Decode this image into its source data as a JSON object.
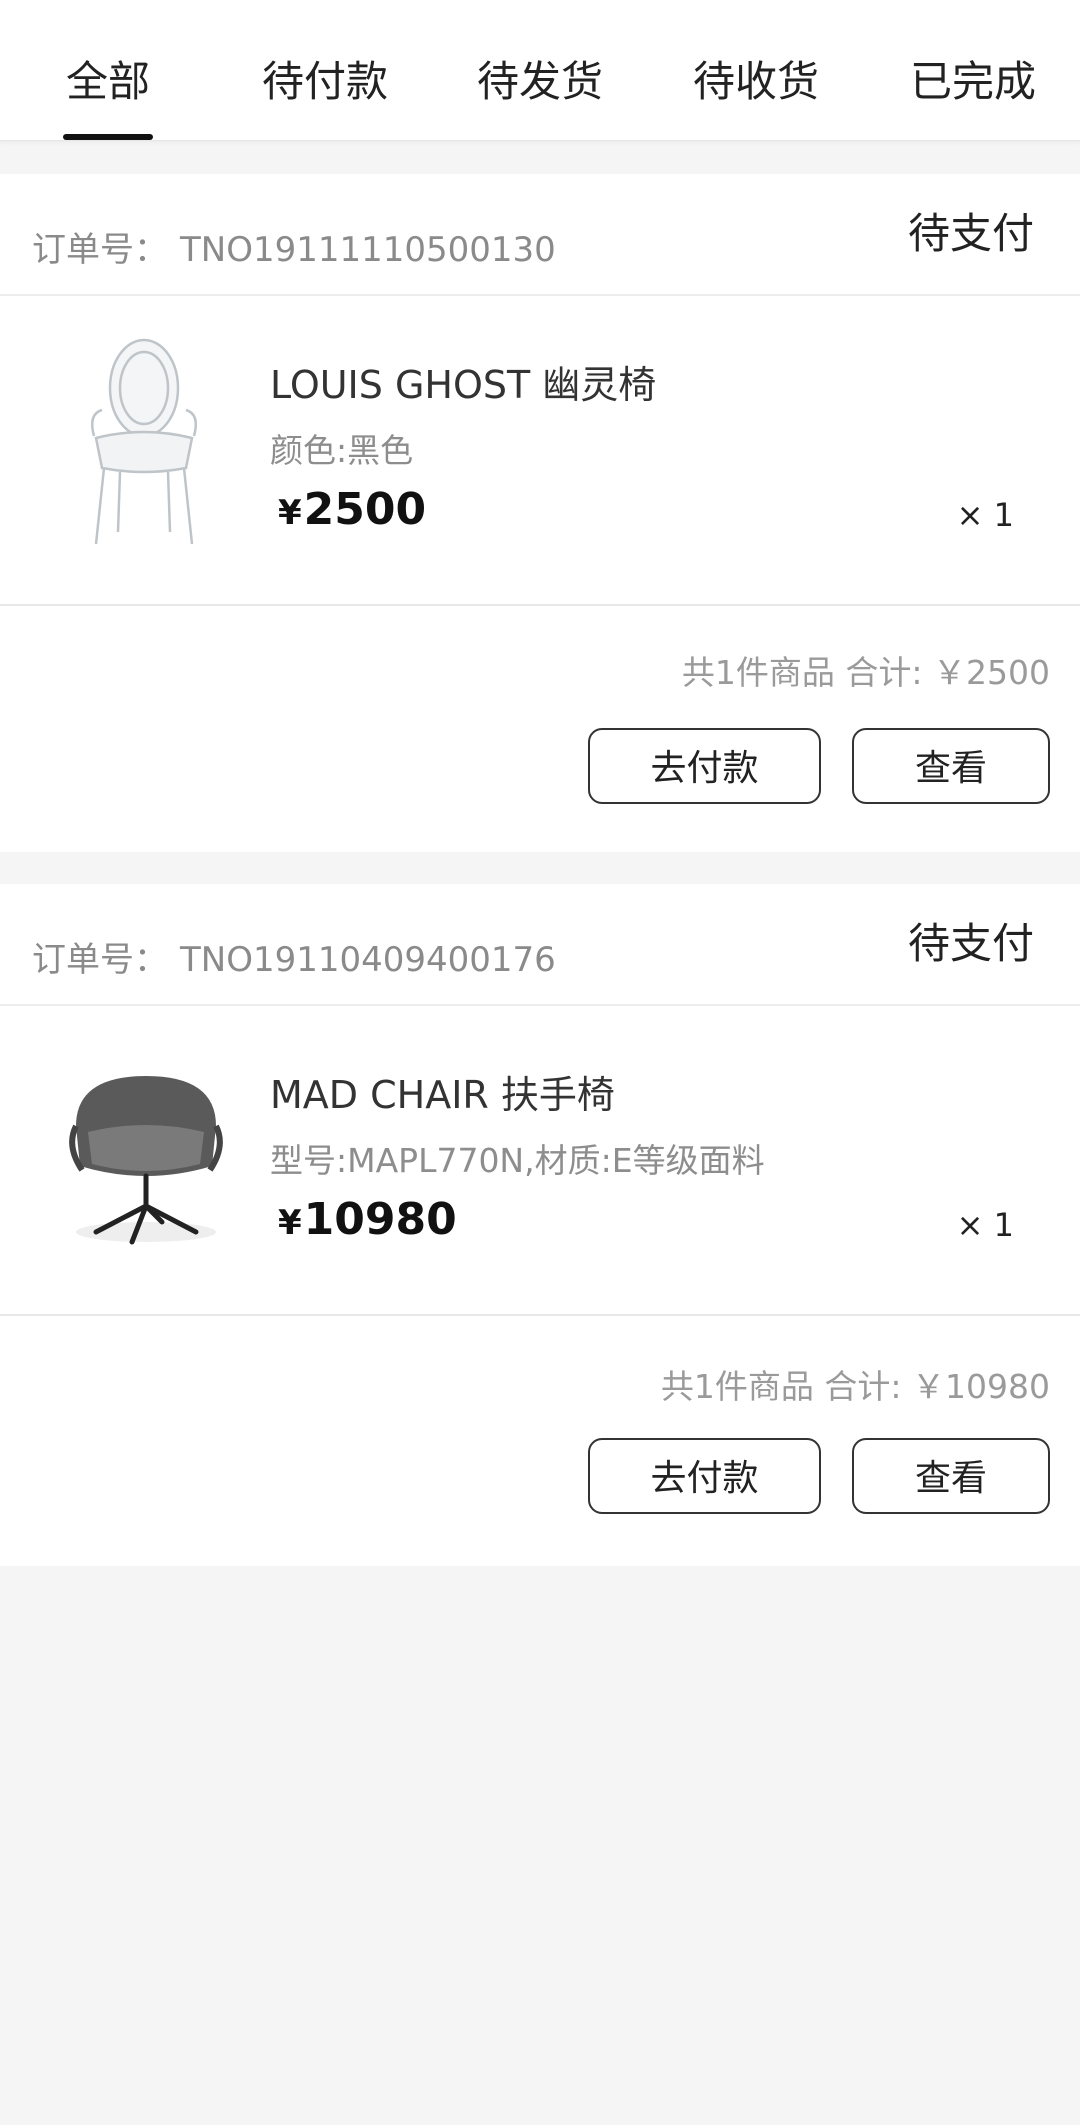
{
  "tabs": [
    "全部",
    "待付款",
    "待发货",
    "待收货",
    "已完成"
  ],
  "active_tab": "全部",
  "orders": [
    {
      "order_no_label": "订单号：",
      "order_no": "TNO19111110500130",
      "status": "待支付",
      "item": {
        "thumb_icon": "ghost-chair-image",
        "name": "LOUIS GHOST 幽灵椅",
        "spec": "颜色:黑色",
        "currency": "¥",
        "price": "2500",
        "qty": "× 1"
      },
      "summary": "共1件商品 合计: ￥2500",
      "pay_button": "去付款",
      "view_button": "查看"
    },
    {
      "order_no_label": "订单号：",
      "order_no": "TNO19110409400176",
      "status": "待支付",
      "item": {
        "thumb_icon": "armchair-image",
        "name": "MAD CHAIR 扶手椅",
        "spec": "型号:MAPL770N,材质:E等级面料",
        "currency": "¥",
        "price": "10980",
        "qty": "× 1"
      },
      "summary": "共1件商品 合计: ￥10980",
      "pay_button": "去付款",
      "view_button": "查看"
    }
  ]
}
